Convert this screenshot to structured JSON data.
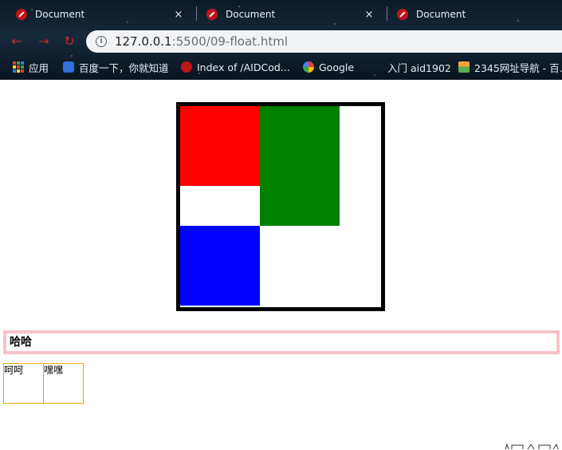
{
  "browser": {
    "tabs": [
      {
        "title": "Document",
        "close": "×"
      },
      {
        "title": "Document",
        "close": "×"
      },
      {
        "title": "Document",
        "close": ""
      }
    ],
    "address": {
      "host": "127.0.0.1",
      "path": ":5500/09-float.html",
      "info_icon": "info-icon"
    },
    "nav": {
      "back_icon": "back-arrow-icon",
      "forward_icon": "forward-arrow-icon",
      "reload_icon": "reload-icon"
    },
    "bookmarks": [
      {
        "label": "应用",
        "icon": "apps-icon"
      },
      {
        "label": "百度一下，你就知道",
        "icon": "baidu-icon"
      },
      {
        "label": "Index of /AIDCod...",
        "icon": "favicon-red-icon"
      },
      {
        "label": "Google",
        "icon": "google-icon"
      },
      {
        "label": "入门 aid1902",
        "icon": ""
      },
      {
        "label": "2345网址导航 - 百...",
        "icon": "2345-icon"
      }
    ]
  },
  "page": {
    "boxes": {
      "red": "#ff0000",
      "green": "#008000",
      "blue": "#0000ff",
      "border": "#000000"
    },
    "pink_bar_text": "哈哈",
    "pink_bar_color": "#f7c2cb",
    "small_boxes": [
      {
        "text": "呵呵"
      },
      {
        "text": "嘿嘿"
      }
    ],
    "small_box_border": "#f0a800"
  }
}
